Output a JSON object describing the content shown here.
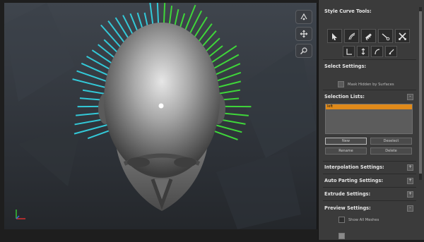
{
  "viewport": {
    "tools": [
      "rotate-tool-icon",
      "move-tool-icon",
      "zoom-tool-icon"
    ],
    "axes": {
      "x": "red",
      "y": "green"
    },
    "colors": {
      "left_strands": "#33c9d8",
      "right_strands": "#3fd63a",
      "head": "#9a9a9a"
    }
  },
  "panel": {
    "style_curve_tools": {
      "title": "Style Curve Tools:",
      "tools_row1": [
        "select-curve-icon",
        "sculpt-curve-icon",
        "comb-curve-icon",
        "cut-curve-icon",
        "scissors-icon"
      ],
      "tools_row2": [
        "length-icon",
        "scale-icon",
        "bend-icon",
        "lift-icon"
      ]
    },
    "select_settings": {
      "title": "Select Settings:",
      "mask_hidden_label": "Mask Hidden by Surfaces"
    },
    "selection_lists": {
      "title": "Selection Lists:",
      "collapse": "-",
      "items": [
        "left"
      ],
      "buttons": {
        "new": "New",
        "deselect": "Deselect",
        "rename": "Rename",
        "delete": "Delete"
      }
    },
    "sections": {
      "interpolation": {
        "title": "Interpolation Settings:",
        "toggle": "+"
      },
      "auto_parting": {
        "title": "Auto Parting Settings:",
        "toggle": "+"
      },
      "extrude": {
        "title": "Extrude Settings:",
        "toggle": "+"
      },
      "preview": {
        "title": "Preview Settings:",
        "toggle": "-",
        "show_all_meshes": "Show All Meshes"
      }
    }
  }
}
